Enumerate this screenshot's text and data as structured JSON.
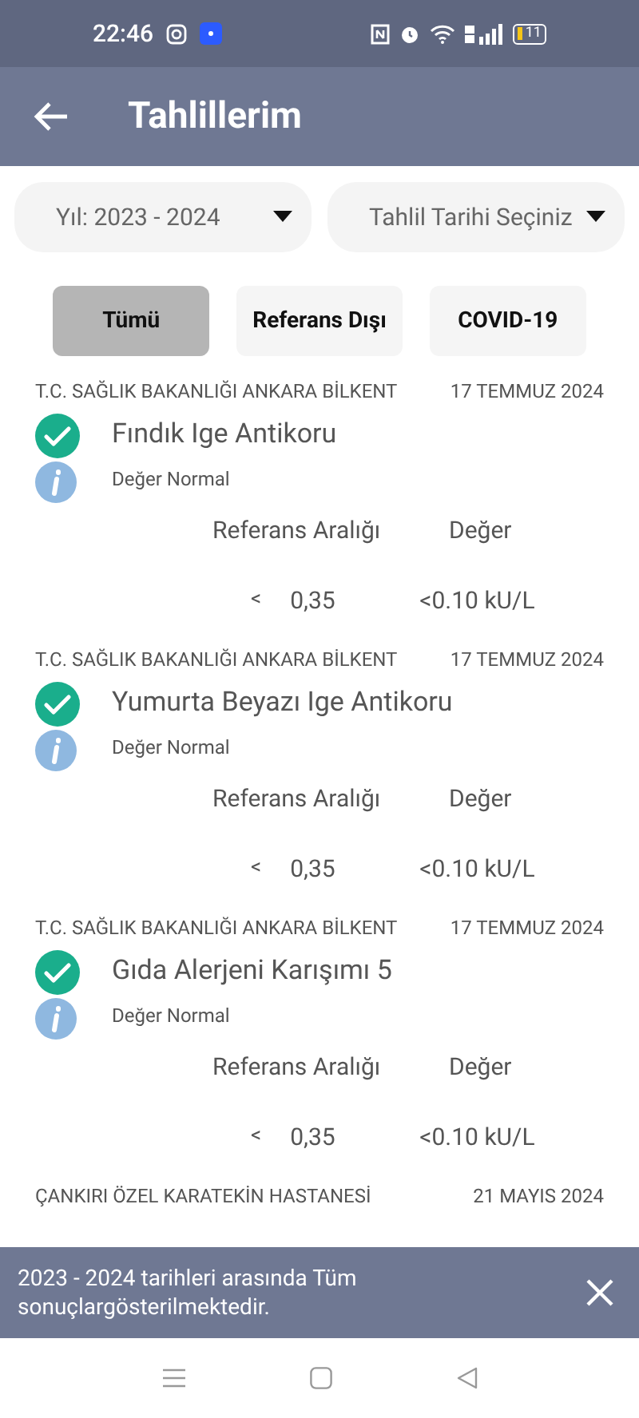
{
  "status_bar": {
    "time": "22:46",
    "battery": "11"
  },
  "header": {
    "title": "Tahlillerim"
  },
  "filters": [
    {
      "label": "Yıl: 2023 - 2024"
    },
    {
      "label": "Tahlil Tarihi Seçiniz"
    }
  ],
  "tabs": [
    {
      "label": "Tümü",
      "selected": true
    },
    {
      "label": "Referans Dışı",
      "selected": false
    },
    {
      "label": "COVID-19",
      "selected": false
    }
  ],
  "results": [
    {
      "hospital": "T.C. SAĞLIK BAKANLIĞI ANKARA BİLKENT",
      "date": "17 TEMMUZ 2024",
      "test": "Fındık Ige Antikoru",
      "normal": true,
      "status": "Değer Normal",
      "range_label": "Referans Aralığı",
      "value_label": "Değer",
      "operator": "<",
      "range": "0,35",
      "value": "<0.10 kU/L"
    },
    {
      "hospital": "T.C. SAĞLIK BAKANLIĞI ANKARA BİLKENT",
      "date": "17 TEMMUZ 2024",
      "test": "Yumurta Beyazı Ige Antikoru",
      "normal": true,
      "status": "Değer Normal",
      "range_label": "Referans Aralığı",
      "value_label": "Değer",
      "operator": "<",
      "range": "0,35",
      "value": "<0.10 kU/L"
    },
    {
      "hospital": "T.C. SAĞLIK BAKANLIĞI ANKARA BİLKENT",
      "date": "17 TEMMUZ 2024",
      "test": "Gıda Alerjeni Karışımı 5",
      "normal": true,
      "status": "Değer Normal",
      "range_label": "Referans Aralığı",
      "value_label": "Değer",
      "operator": "<",
      "range": "0,35",
      "value": "<0.10 kU/L"
    },
    {
      "hospital": "ÇANKIRI ÖZEL KARATEKİN HASTANESİ",
      "date": "21 MAYIS 2024"
    }
  ],
  "snackbar": {
    "message": "2023 - 2024 tarihleri arasında Tüm sonuçlargösterilmektedir."
  }
}
